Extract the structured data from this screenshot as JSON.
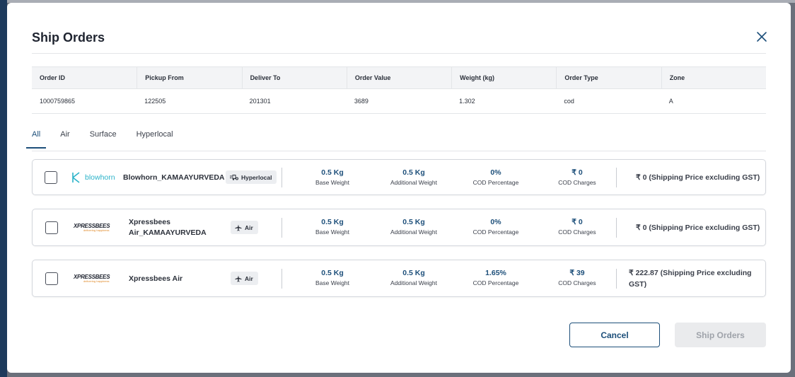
{
  "modal": {
    "title": "Ship Orders",
    "close_icon": "close-icon"
  },
  "order_table": {
    "headers": [
      "Order ID",
      "Pickup From",
      "Deliver To",
      "Order Value",
      "Weight (kg)",
      "Order Type",
      "Zone"
    ],
    "row": [
      "1000759865",
      "122505",
      "201301",
      "3689",
      "1.302",
      "cod",
      "A"
    ]
  },
  "tabs": [
    {
      "label": "All",
      "active": true
    },
    {
      "label": "Air",
      "active": false
    },
    {
      "label": "Surface",
      "active": false
    },
    {
      "label": "Hyperlocal",
      "active": false
    }
  ],
  "couriers": [
    {
      "logo_text": "blowhorn",
      "logo_icon": "blowhorn-logo-icon",
      "name_line1": "Blowhorn_KAMAAYURVEDA",
      "name_line2": "",
      "mode": "Hyperlocal",
      "mode_icon": "hyperlocal-icon",
      "base_weight": "0.5 Kg",
      "additional_weight": "0.5 Kg",
      "cod_percentage": "0%",
      "cod_charges": "₹ 0",
      "price_line1": "₹ 0 (Shipping Price excluding GST)",
      "price_line2": ""
    },
    {
      "logo_text": "XPRESSBEES",
      "logo_tagline": "delivering happiness",
      "name_line1": "Xpressbees",
      "name_line2": "Air_KAMAAYURVEDA",
      "mode": "Air",
      "mode_icon": "airplane-icon",
      "base_weight": "0.5 Kg",
      "additional_weight": "0.5 Kg",
      "cod_percentage": "0%",
      "cod_charges": "₹ 0",
      "price_line1": "₹ 0 (Shipping Price excluding GST)",
      "price_line2": ""
    },
    {
      "logo_text": "XPRESSBEES",
      "logo_tagline": "delivering happiness",
      "name_line1": "Xpressbees Air",
      "name_line2": "",
      "mode": "Air",
      "mode_icon": "airplane-icon",
      "base_weight": "0.5 Kg",
      "additional_weight": "0.5 Kg",
      "cod_percentage": "1.65%",
      "cod_charges": "₹ 39",
      "price_line1": "₹ 222.87 (Shipping Price excluding",
      "price_line2": "GST)"
    }
  ],
  "metric_labels": {
    "base_weight": "Base Weight",
    "additional_weight": "Additional Weight",
    "cod_percentage": "COD Percentage",
    "cod_charges": "COD Charges"
  },
  "buttons": {
    "cancel": "Cancel",
    "ship": "Ship Orders"
  },
  "colors": {
    "accent": "#1d4f7a",
    "blowhorn": "#2bb3c9",
    "disabled_bg": "#eaebed"
  }
}
